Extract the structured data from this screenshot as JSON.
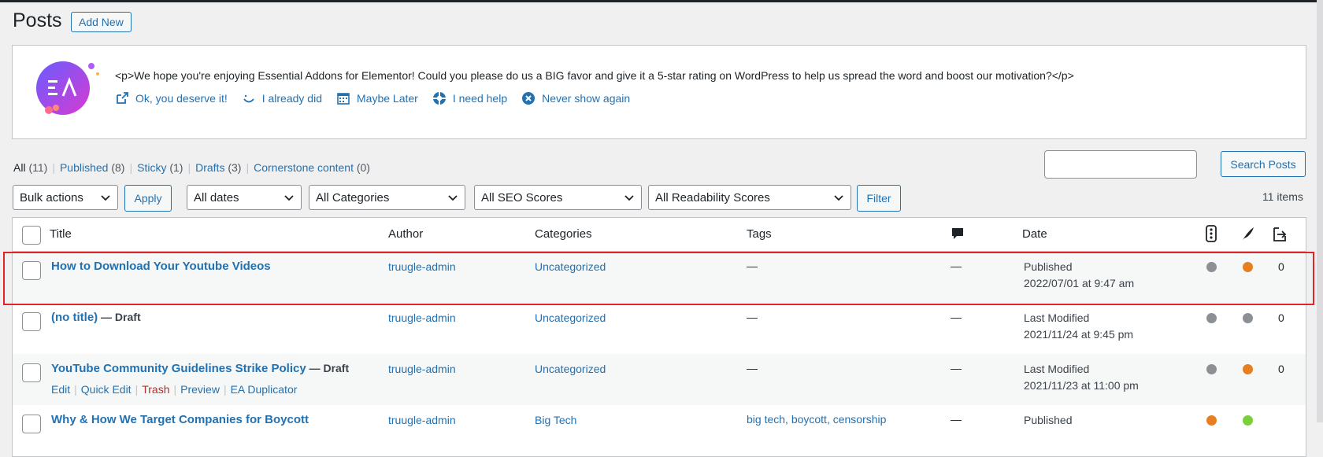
{
  "page": {
    "title": "Posts",
    "add_new": "Add New"
  },
  "notice": {
    "message": "<p>We hope you're enjoying Essential Addons for Elementor! Could you please do us a BIG favor and give it a 5-star rating on WordPress to help us spread the word and boost our motivation?</p>",
    "actions": [
      {
        "label": "Ok, you deserve it!",
        "icon": "external-link-icon"
      },
      {
        "label": "I already did",
        "icon": "smile-icon"
      },
      {
        "label": "Maybe Later",
        "icon": "calendar-icon"
      },
      {
        "label": "I need help",
        "icon": "help-icon"
      },
      {
        "label": "Never show again",
        "icon": "close-circle-icon"
      }
    ],
    "logo_text": "EA"
  },
  "filters_links": [
    {
      "label": "All",
      "count": "(11)"
    },
    {
      "label": "Published",
      "count": "(8)"
    },
    {
      "label": "Sticky",
      "count": "(1)"
    },
    {
      "label": "Drafts",
      "count": "(3)"
    },
    {
      "label": "Cornerstone content",
      "count": "(0)"
    }
  ],
  "search": {
    "button": "Search Posts",
    "value": ""
  },
  "toolbar": {
    "bulk": "Bulk actions",
    "apply": "Apply",
    "dates": "All dates",
    "categories": "All Categories",
    "seo": "All SEO Scores",
    "readability": "All Readability Scores",
    "filter": "Filter",
    "items": "11 items"
  },
  "columns": {
    "title": "Title",
    "author": "Author",
    "categories": "Categories",
    "tags": "Tags",
    "date": "Date"
  },
  "rows": [
    {
      "title": "How to Download Your Youtube Videos",
      "state": "",
      "author": "truugle-admin",
      "category": "Uncategorized",
      "tags": "—",
      "comments": "—",
      "date_status": "Published",
      "date": "2022/07/01 at 9:47 am",
      "seo_color": "#8c8f94",
      "read_color": "#e67e22",
      "links": "0"
    },
    {
      "title": "(no title)",
      "state": "— Draft",
      "author": "truugle-admin",
      "category": "Uncategorized",
      "tags": "—",
      "comments": "—",
      "date_status": "Last Modified",
      "date": "2021/11/24 at 9:45 pm",
      "seo_color": "#8c8f94",
      "read_color": "#8c8f94",
      "links": "0"
    },
    {
      "title": "YouTube Community Guidelines Strike Policy",
      "state": "— Draft",
      "author": "truugle-admin",
      "category": "Uncategorized",
      "tags": "—",
      "comments": "—",
      "date_status": "Last Modified",
      "date": "2021/11/23 at 11:00 pm",
      "seo_color": "#8c8f94",
      "read_color": "#e67e22",
      "links": "0",
      "row_actions": [
        "Edit",
        "Quick Edit",
        "Trash",
        "Preview",
        "EA Duplicator"
      ]
    },
    {
      "title": "Why & How We Target Companies for Boycott",
      "state": "",
      "author": "truugle-admin",
      "category": "Big Tech",
      "tags": "big tech, boycott, censorship",
      "comments": "—",
      "date_status": "Published",
      "date": "",
      "seo_color": "#e67e22",
      "read_color": "#7ad03a",
      "links": ""
    }
  ]
}
